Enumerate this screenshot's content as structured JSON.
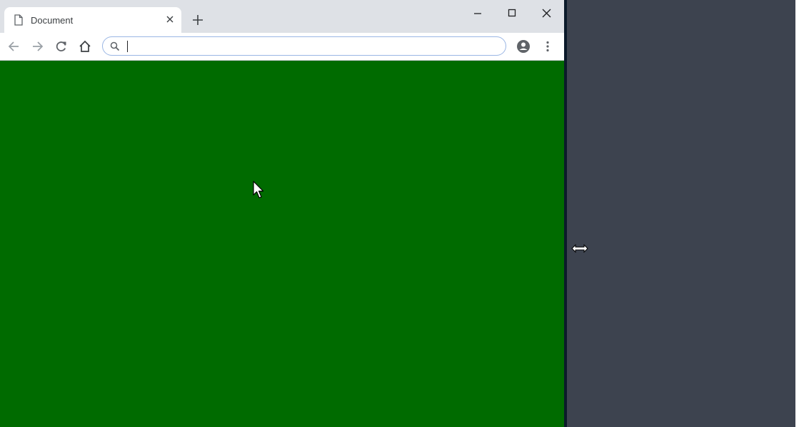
{
  "browser": {
    "tab": {
      "title": "Document",
      "icon": "document-icon",
      "close_icon": "close-icon"
    },
    "new_tab_icon": "plus-icon",
    "window_controls": [
      "minimize-icon",
      "maximize-icon",
      "close-icon"
    ],
    "toolbar": {
      "back_icon": "arrow-left-icon",
      "forward_icon": "arrow-right-icon",
      "reload_icon": "reload-icon",
      "home_icon": "home-icon",
      "omnibox": {
        "value": "",
        "placeholder": "",
        "icon": "search-icon"
      },
      "profile_icon": "account-circle-icon",
      "menu_icon": "kebab-menu-icon"
    },
    "content": {
      "background_color": "#006b00"
    }
  },
  "desktop": {
    "background_color": "#3d434f"
  },
  "cursors": {
    "pointer": "arrow-cursor-icon",
    "resize": "horizontal-resize-cursor-icon"
  }
}
